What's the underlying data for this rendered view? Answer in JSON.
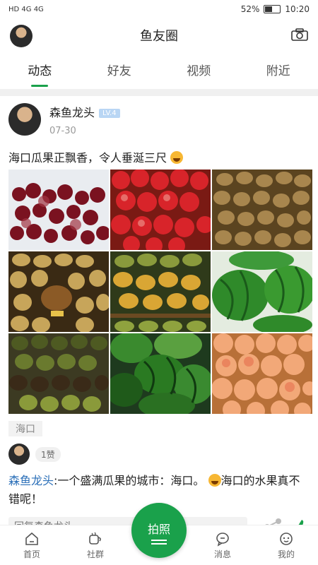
{
  "status": {
    "left": "HD 4G 4G",
    "battery": "52%",
    "time": "10:20"
  },
  "header": {
    "title": "鱼友圈"
  },
  "tabs": [
    {
      "label": "动态"
    },
    {
      "label": "好友"
    },
    {
      "label": "视频"
    },
    {
      "label": "附近"
    }
  ],
  "post": {
    "user": "森鱼龙头",
    "level": "LV.4",
    "date": "07-30",
    "text": "海口瓜果正飘香，令人垂涎三尺",
    "location": "海口",
    "likes": "1赞",
    "comment_user": "森鱼龙头",
    "comment_text": ":一个盛满瓜果的城市：海口。",
    "comment_tail": "海口的水果真不错呢！",
    "reply_placeholder": "回复森鱼龙头",
    "photos": [
      "grapes-photo",
      "apples-photo",
      "kiwi-photo",
      "golden-kiwi-photo",
      "mango-photo",
      "watermelon-photo",
      "avocado-photo",
      "melon-photo",
      "peach-photo"
    ]
  },
  "nav": [
    {
      "label": "首页",
      "icon": "home-icon"
    },
    {
      "label": "社群",
      "icon": "group-icon"
    },
    {
      "label": "拍照",
      "icon": "camera-shoot-icon"
    },
    {
      "label": "消息",
      "icon": "message-icon"
    },
    {
      "label": "我的",
      "icon": "profile-icon"
    }
  ],
  "colors": {
    "accent": "#1aa14b",
    "link": "#2b6fb8",
    "level": "#b9d6f4"
  }
}
